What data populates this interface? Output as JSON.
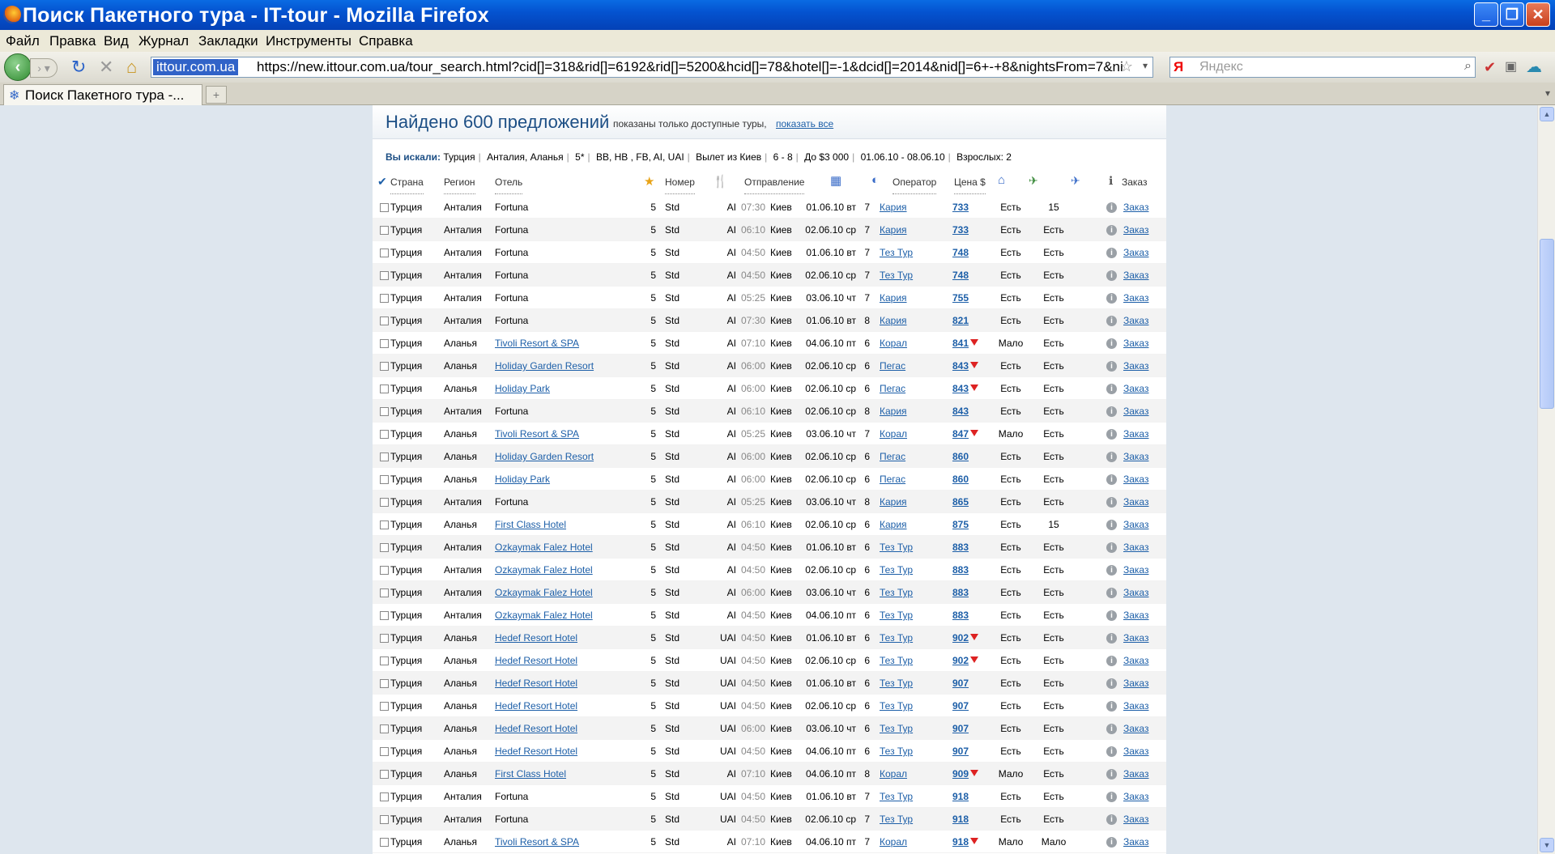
{
  "window": {
    "title": "Поиск Пакетного тура - IT-tour - Mozilla Firefox"
  },
  "menu": [
    "Файл",
    "Правка",
    "Вид",
    "Журнал",
    "Закладки",
    "Инструменты",
    "Справка"
  ],
  "nav": {
    "site": "ittour.com.ua",
    "url": "https://new.ittour.com.ua/tour_search.html?cid[]=318&rid[]=6192&rid[]=5200&hcid[]=78&hotel[]=-1&dcid[]=2014&nid[]=6+-+8&nightsFrom=7&ni",
    "search_placeholder": "Яндекс",
    "search_engine_glyph": "Я"
  },
  "tab": {
    "label": "Поиск Пакетного тура -..."
  },
  "page": {
    "found": "Найдено 600 предложений",
    "found_note": "показаны только доступные туры,",
    "show_all": "показать все",
    "criteria_label": "Вы искали:",
    "criteria": [
      "Турция",
      "Анталия, Аланья",
      "5*",
      "BB, HB , FB, AI, UAI",
      "Вылет из Киев",
      "6 - 8",
      "До $3 000",
      "01.06.10 - 08.06.10",
      "Взрослых: 2"
    ]
  },
  "columns": {
    "country": "Страна",
    "region": "Регион",
    "hotel": "Отель",
    "room": "Номер",
    "departure": "Отправление",
    "operator": "Оператор",
    "price": "Цена $",
    "order": "Заказ"
  },
  "rows": [
    {
      "country": "Турция",
      "region": "Анталия",
      "hotel": "Fortuna",
      "link": false,
      "stars": "5",
      "room": "Std",
      "food": "AI",
      "time": "07:30",
      "city": "Киев",
      "date": "01.06.10 вт",
      "nights": "7",
      "operator": "Кария",
      "price": "733",
      "down": false,
      "hotel_av": "Есть",
      "flight": "15",
      "order": "Заказ"
    },
    {
      "country": "Турция",
      "region": "Анталия",
      "hotel": "Fortuna",
      "link": false,
      "stars": "5",
      "room": "Std",
      "food": "AI",
      "time": "06:10",
      "city": "Киев",
      "date": "02.06.10 ср",
      "nights": "7",
      "operator": "Кария",
      "price": "733",
      "down": false,
      "hotel_av": "Есть",
      "flight": "Есть",
      "order": "Заказ"
    },
    {
      "country": "Турция",
      "region": "Анталия",
      "hotel": "Fortuna",
      "link": false,
      "stars": "5",
      "room": "Std",
      "food": "AI",
      "time": "04:50",
      "city": "Киев",
      "date": "01.06.10 вт",
      "nights": "7",
      "operator": "Тез Тур",
      "price": "748",
      "down": false,
      "hotel_av": "Есть",
      "flight": "Есть",
      "order": "Заказ"
    },
    {
      "country": "Турция",
      "region": "Анталия",
      "hotel": "Fortuna",
      "link": false,
      "stars": "5",
      "room": "Std",
      "food": "AI",
      "time": "04:50",
      "city": "Киев",
      "date": "02.06.10 ср",
      "nights": "7",
      "operator": "Тез Тур",
      "price": "748",
      "down": false,
      "hotel_av": "Есть",
      "flight": "Есть",
      "order": "Заказ"
    },
    {
      "country": "Турция",
      "region": "Анталия",
      "hotel": "Fortuna",
      "link": false,
      "stars": "5",
      "room": "Std",
      "food": "AI",
      "time": "05:25",
      "city": "Киев",
      "date": "03.06.10 чт",
      "nights": "7",
      "operator": "Кария",
      "price": "755",
      "down": false,
      "hotel_av": "Есть",
      "flight": "Есть",
      "order": "Заказ"
    },
    {
      "country": "Турция",
      "region": "Анталия",
      "hotel": "Fortuna",
      "link": false,
      "stars": "5",
      "room": "Std",
      "food": "AI",
      "time": "07:30",
      "city": "Киев",
      "date": "01.06.10 вт",
      "nights": "8",
      "operator": "Кария",
      "price": "821",
      "down": false,
      "hotel_av": "Есть",
      "flight": "Есть",
      "order": "Заказ"
    },
    {
      "country": "Турция",
      "region": "Аланья",
      "hotel": "Tivoli Resort & SPA",
      "link": true,
      "stars": "5",
      "room": "Std",
      "food": "AI",
      "time": "07:10",
      "city": "Киев",
      "date": "04.06.10 пт",
      "nights": "6",
      "operator": "Корал",
      "price": "841",
      "down": true,
      "hotel_av": "Мало",
      "flight": "Есть",
      "order": "Заказ"
    },
    {
      "country": "Турция",
      "region": "Аланья",
      "hotel": "Holiday Garden Resort",
      "link": true,
      "stars": "5",
      "room": "Std",
      "food": "AI",
      "time": "06:00",
      "city": "Киев",
      "date": "02.06.10 ср",
      "nights": "6",
      "operator": "Пегас",
      "price": "843",
      "down": true,
      "hotel_av": "Есть",
      "flight": "Есть",
      "order": "Заказ"
    },
    {
      "country": "Турция",
      "region": "Аланья",
      "hotel": "Holiday Park",
      "link": true,
      "stars": "5",
      "room": "Std",
      "food": "AI",
      "time": "06:00",
      "city": "Киев",
      "date": "02.06.10 ср",
      "nights": "6",
      "operator": "Пегас",
      "price": "843",
      "down": true,
      "hotel_av": "Есть",
      "flight": "Есть",
      "order": "Заказ"
    },
    {
      "country": "Турция",
      "region": "Анталия",
      "hotel": "Fortuna",
      "link": false,
      "stars": "5",
      "room": "Std",
      "food": "AI",
      "time": "06:10",
      "city": "Киев",
      "date": "02.06.10 ср",
      "nights": "8",
      "operator": "Кария",
      "price": "843",
      "down": false,
      "hotel_av": "Есть",
      "flight": "Есть",
      "order": "Заказ"
    },
    {
      "country": "Турция",
      "region": "Аланья",
      "hotel": "Tivoli Resort & SPA",
      "link": true,
      "stars": "5",
      "room": "Std",
      "food": "AI",
      "time": "05:25",
      "city": "Киев",
      "date": "03.06.10 чт",
      "nights": "7",
      "operator": "Корал",
      "price": "847",
      "down": true,
      "hotel_av": "Мало",
      "flight": "Есть",
      "order": "Заказ"
    },
    {
      "country": "Турция",
      "region": "Аланья",
      "hotel": "Holiday Garden Resort",
      "link": true,
      "stars": "5",
      "room": "Std",
      "food": "AI",
      "time": "06:00",
      "city": "Киев",
      "date": "02.06.10 ср",
      "nights": "6",
      "operator": "Пегас",
      "price": "860",
      "down": false,
      "hotel_av": "Есть",
      "flight": "Есть",
      "order": "Заказ"
    },
    {
      "country": "Турция",
      "region": "Аланья",
      "hotel": "Holiday Park",
      "link": true,
      "stars": "5",
      "room": "Std",
      "food": "AI",
      "time": "06:00",
      "city": "Киев",
      "date": "02.06.10 ср",
      "nights": "6",
      "operator": "Пегас",
      "price": "860",
      "down": false,
      "hotel_av": "Есть",
      "flight": "Есть",
      "order": "Заказ"
    },
    {
      "country": "Турция",
      "region": "Анталия",
      "hotel": "Fortuna",
      "link": false,
      "stars": "5",
      "room": "Std",
      "food": "AI",
      "time": "05:25",
      "city": "Киев",
      "date": "03.06.10 чт",
      "nights": "8",
      "operator": "Кария",
      "price": "865",
      "down": false,
      "hotel_av": "Есть",
      "flight": "Есть",
      "order": "Заказ"
    },
    {
      "country": "Турция",
      "region": "Аланья",
      "hotel": "First Class Hotel",
      "link": true,
      "stars": "5",
      "room": "Std",
      "food": "AI",
      "time": "06:10",
      "city": "Киев",
      "date": "02.06.10 ср",
      "nights": "6",
      "operator": "Кария",
      "price": "875",
      "down": false,
      "hotel_av": "Есть",
      "flight": "15",
      "order": "Заказ"
    },
    {
      "country": "Турция",
      "region": "Анталия",
      "hotel": "Ozkaymak Falez Hotel",
      "link": true,
      "stars": "5",
      "room": "Std",
      "food": "AI",
      "time": "04:50",
      "city": "Киев",
      "date": "01.06.10 вт",
      "nights": "6",
      "operator": "Тез Тур",
      "price": "883",
      "down": false,
      "hotel_av": "Есть",
      "flight": "Есть",
      "order": "Заказ"
    },
    {
      "country": "Турция",
      "region": "Анталия",
      "hotel": "Ozkaymak Falez Hotel",
      "link": true,
      "stars": "5",
      "room": "Std",
      "food": "AI",
      "time": "04:50",
      "city": "Киев",
      "date": "02.06.10 ср",
      "nights": "6",
      "operator": "Тез Тур",
      "price": "883",
      "down": false,
      "hotel_av": "Есть",
      "flight": "Есть",
      "order": "Заказ"
    },
    {
      "country": "Турция",
      "region": "Анталия",
      "hotel": "Ozkaymak Falez Hotel",
      "link": true,
      "stars": "5",
      "room": "Std",
      "food": "AI",
      "time": "06:00",
      "city": "Киев",
      "date": "03.06.10 чт",
      "nights": "6",
      "operator": "Тез Тур",
      "price": "883",
      "down": false,
      "hotel_av": "Есть",
      "flight": "Есть",
      "order": "Заказ"
    },
    {
      "country": "Турция",
      "region": "Анталия",
      "hotel": "Ozkaymak Falez Hotel",
      "link": true,
      "stars": "5",
      "room": "Std",
      "food": "AI",
      "time": "04:50",
      "city": "Киев",
      "date": "04.06.10 пт",
      "nights": "6",
      "operator": "Тез Тур",
      "price": "883",
      "down": false,
      "hotel_av": "Есть",
      "flight": "Есть",
      "order": "Заказ"
    },
    {
      "country": "Турция",
      "region": "Аланья",
      "hotel": "Hedef Resort Hotel",
      "link": true,
      "stars": "5",
      "room": "Std",
      "food": "UAI",
      "time": "04:50",
      "city": "Киев",
      "date": "01.06.10 вт",
      "nights": "6",
      "operator": "Тез Тур",
      "price": "902",
      "down": true,
      "hotel_av": "Есть",
      "flight": "Есть",
      "order": "Заказ"
    },
    {
      "country": "Турция",
      "region": "Аланья",
      "hotel": "Hedef Resort Hotel",
      "link": true,
      "stars": "5",
      "room": "Std",
      "food": "UAI",
      "time": "04:50",
      "city": "Киев",
      "date": "02.06.10 ср",
      "nights": "6",
      "operator": "Тез Тур",
      "price": "902",
      "down": true,
      "hotel_av": "Есть",
      "flight": "Есть",
      "order": "Заказ"
    },
    {
      "country": "Турция",
      "region": "Аланья",
      "hotel": "Hedef Resort Hotel",
      "link": true,
      "stars": "5",
      "room": "Std",
      "food": "UAI",
      "time": "04:50",
      "city": "Киев",
      "date": "01.06.10 вт",
      "nights": "6",
      "operator": "Тез Тур",
      "price": "907",
      "down": false,
      "hotel_av": "Есть",
      "flight": "Есть",
      "order": "Заказ"
    },
    {
      "country": "Турция",
      "region": "Аланья",
      "hotel": "Hedef Resort Hotel",
      "link": true,
      "stars": "5",
      "room": "Std",
      "food": "UAI",
      "time": "04:50",
      "city": "Киев",
      "date": "02.06.10 ср",
      "nights": "6",
      "operator": "Тез Тур",
      "price": "907",
      "down": false,
      "hotel_av": "Есть",
      "flight": "Есть",
      "order": "Заказ"
    },
    {
      "country": "Турция",
      "region": "Аланья",
      "hotel": "Hedef Resort Hotel",
      "link": true,
      "stars": "5",
      "room": "Std",
      "food": "UAI",
      "time": "06:00",
      "city": "Киев",
      "date": "03.06.10 чт",
      "nights": "6",
      "operator": "Тез Тур",
      "price": "907",
      "down": false,
      "hotel_av": "Есть",
      "flight": "Есть",
      "order": "Заказ"
    },
    {
      "country": "Турция",
      "region": "Аланья",
      "hotel": "Hedef Resort Hotel",
      "link": true,
      "stars": "5",
      "room": "Std",
      "food": "UAI",
      "time": "04:50",
      "city": "Киев",
      "date": "04.06.10 пт",
      "nights": "6",
      "operator": "Тез Тур",
      "price": "907",
      "down": false,
      "hotel_av": "Есть",
      "flight": "Есть",
      "order": "Заказ"
    },
    {
      "country": "Турция",
      "region": "Аланья",
      "hotel": "First Class Hotel",
      "link": true,
      "stars": "5",
      "room": "Std",
      "food": "AI",
      "time": "07:10",
      "city": "Киев",
      "date": "04.06.10 пт",
      "nights": "8",
      "operator": "Корал",
      "price": "909",
      "down": true,
      "hotel_av": "Мало",
      "flight": "Есть",
      "order": "Заказ"
    },
    {
      "country": "Турция",
      "region": "Анталия",
      "hotel": "Fortuna",
      "link": false,
      "stars": "5",
      "room": "Std",
      "food": "UAI",
      "time": "04:50",
      "city": "Киев",
      "date": "01.06.10 вт",
      "nights": "7",
      "operator": "Тез Тур",
      "price": "918",
      "down": false,
      "hotel_av": "Есть",
      "flight": "Есть",
      "order": "Заказ"
    },
    {
      "country": "Турция",
      "region": "Анталия",
      "hotel": "Fortuna",
      "link": false,
      "stars": "5",
      "room": "Std",
      "food": "UAI",
      "time": "04:50",
      "city": "Киев",
      "date": "02.06.10 ср",
      "nights": "7",
      "operator": "Тез Тур",
      "price": "918",
      "down": false,
      "hotel_av": "Есть",
      "flight": "Есть",
      "order": "Заказ"
    },
    {
      "country": "Турция",
      "region": "Аланья",
      "hotel": "Tivoli Resort & SPA",
      "link": true,
      "stars": "5",
      "room": "Std",
      "food": "AI",
      "time": "07:10",
      "city": "Киев",
      "date": "04.06.10 пт",
      "nights": "7",
      "operator": "Корал",
      "price": "918",
      "down": true,
      "hotel_av": "Мало",
      "flight": "Мало",
      "order": "Заказ"
    }
  ]
}
